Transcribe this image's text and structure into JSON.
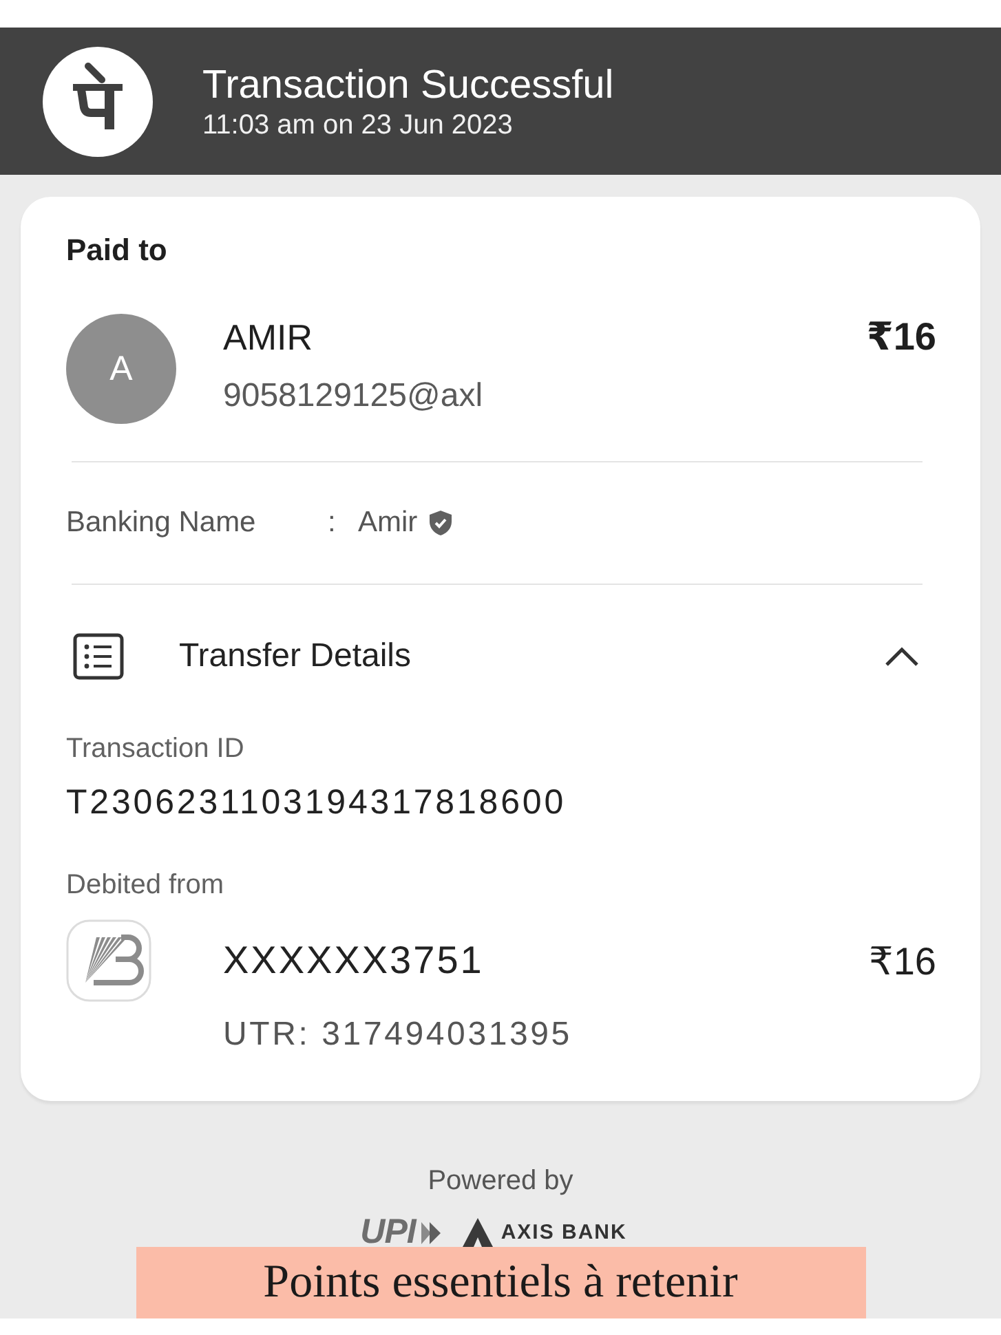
{
  "header": {
    "title": "Transaction Successful",
    "time": "11:03 am on 23 Jun 2023"
  },
  "paid_to": {
    "heading": "Paid to",
    "avatar_initial": "A",
    "name": "AMIR",
    "upi_id": "9058129125@axl",
    "amount": "₹16"
  },
  "banking_name": {
    "label": "Banking Name",
    "separator": ":",
    "value": "Amir",
    "verified": true
  },
  "transfer_details": {
    "title": "Transfer Details",
    "expanded": true,
    "transaction_id_label": "Transaction ID",
    "transaction_id": "T2306231103194317818600",
    "debited_from_label": "Debited from",
    "account": "XXXXXX3751",
    "amount": "₹16",
    "utr": "UTR: 317494031395"
  },
  "footer": {
    "powered_by": "Powered by",
    "partners": [
      {
        "kind": "upi",
        "text": "UPI"
      },
      {
        "kind": "bank",
        "text": "AXIS BANK"
      }
    ]
  },
  "banner": {
    "text": "Points essentiels à retenir"
  }
}
